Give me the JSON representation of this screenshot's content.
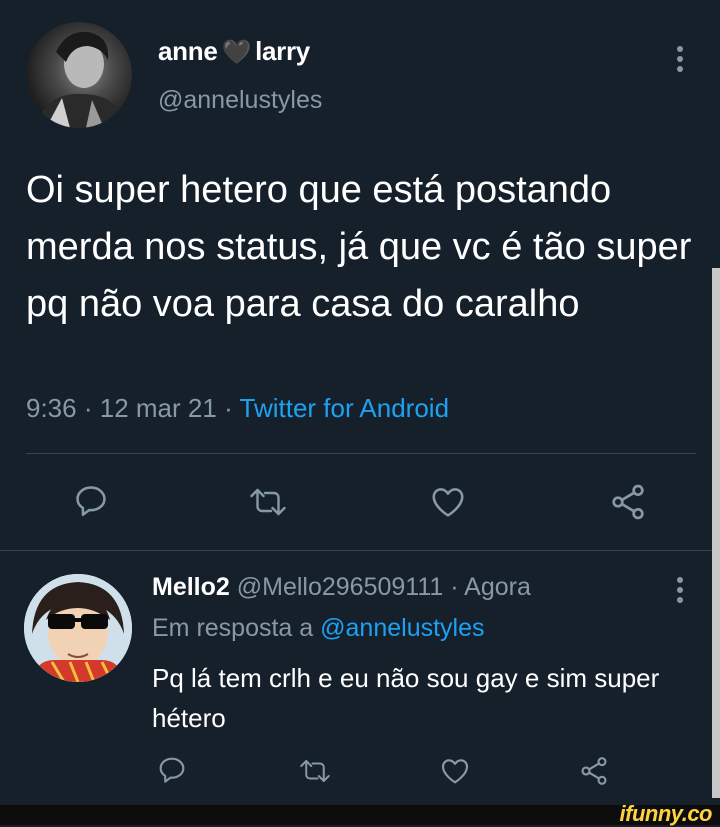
{
  "tweet": {
    "author_name_first": "anne",
    "author_name_heart": "🖤",
    "author_name_last": "larry",
    "handle": "@annelustyles",
    "text": "Oi super hetero que está postando merda nos status, já que vc é tão super pq não voa para casa do caralho",
    "time": "9:36",
    "date": "12 mar 21",
    "separator": "·",
    "source": "Twitter for Android"
  },
  "reply": {
    "author_name": "Mello2",
    "handle": "@Mello296509111",
    "time": "Agora",
    "separator": "·",
    "in_reply_prefix": "Em resposta a",
    "in_reply_to": "@annelustyles",
    "text": "Pq lá tem crlh e eu não sou gay e sim super hétero"
  },
  "more_glyph": "⋮",
  "watermark": "ifunny.co",
  "icons": [
    "reply-icon",
    "retweet-icon",
    "like-icon",
    "share-icon",
    "more-icon"
  ],
  "colors": {
    "background": "#15202b",
    "secondary_text": "#8899a6",
    "link": "#1da1f2",
    "divider": "#38444d"
  }
}
